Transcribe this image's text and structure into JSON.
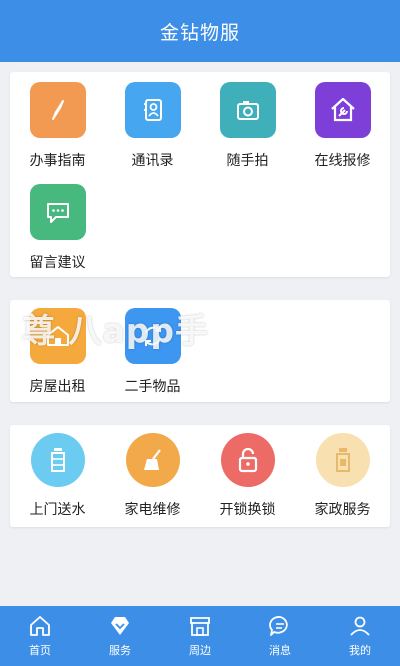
{
  "header": {
    "title": "金钻物服"
  },
  "section1": {
    "items": [
      {
        "label": "办事指南",
        "icon": "compass-icon",
        "color": "#f29a52"
      },
      {
        "label": "通讯录",
        "icon": "contacts-icon",
        "color": "#46a6f0"
      },
      {
        "label": "随手拍",
        "icon": "camera-icon",
        "color": "#3fb0b9"
      },
      {
        "label": "在线报修",
        "icon": "house-wrench-icon",
        "color": "#7d3fd8"
      },
      {
        "label": "留言建议",
        "icon": "message-icon",
        "color": "#47b87e"
      }
    ]
  },
  "section2": {
    "watermark": "尊 八app手",
    "items": [
      {
        "label": "房屋出租",
        "icon": "house-rent-icon",
        "color": "#f5a93d"
      },
      {
        "label": "二手物品",
        "icon": "second-hand-icon",
        "color": "#3d96f0"
      }
    ]
  },
  "section3": {
    "items": [
      {
        "label": "上门送水",
        "icon": "water-bottle-icon",
        "color": "#6ccbf0"
      },
      {
        "label": "家电维修",
        "icon": "broom-icon",
        "color": "#f2a94a"
      },
      {
        "label": "开锁换锁",
        "icon": "unlock-icon",
        "color": "#ec6b66"
      },
      {
        "label": "家政服务",
        "icon": "jar-icon",
        "color": "#f8e0b0"
      }
    ]
  },
  "tabbar": {
    "tabs": [
      {
        "label": "首页",
        "icon": "home-icon"
      },
      {
        "label": "服务",
        "icon": "diamond-icon"
      },
      {
        "label": "周边",
        "icon": "shop-icon"
      },
      {
        "label": "消息",
        "icon": "chat-icon"
      },
      {
        "label": "我的",
        "icon": "user-icon"
      }
    ]
  },
  "colors": {
    "primary": "#3d8ee6",
    "background": "#eef0f4"
  }
}
